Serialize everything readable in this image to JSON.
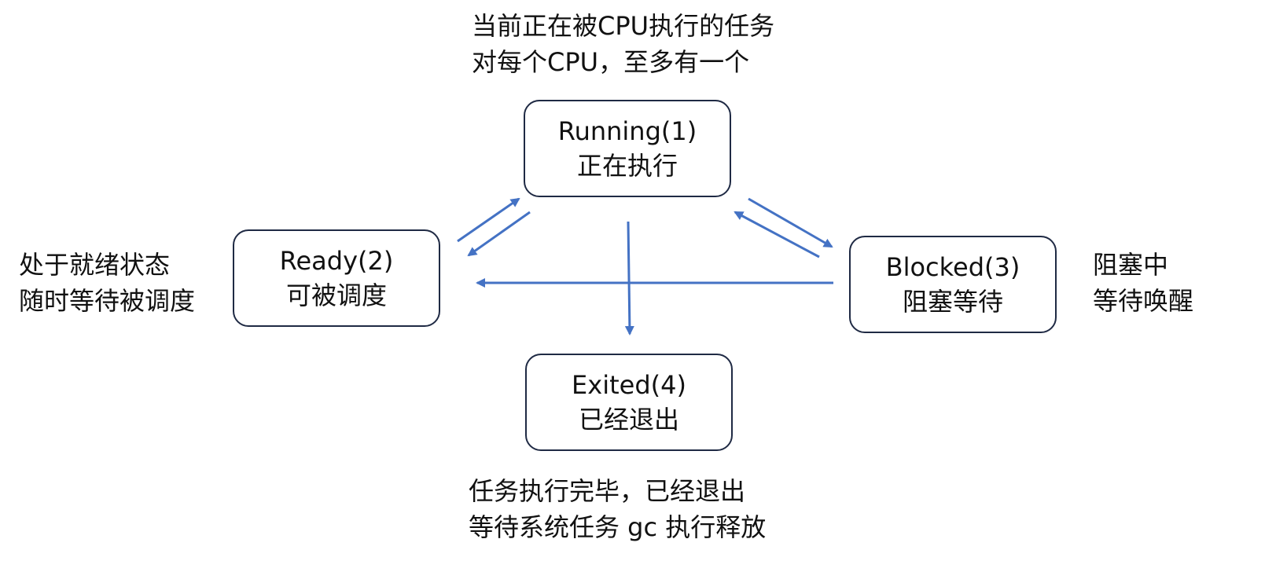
{
  "states": {
    "running": {
      "name": "Running(1)",
      "desc": "正在执行"
    },
    "ready": {
      "name": "Ready(2)",
      "desc": "可被调度"
    },
    "blocked": {
      "name": "Blocked(3)",
      "desc": "阻塞等待"
    },
    "exited": {
      "name": "Exited(4)",
      "desc": "已经退出"
    }
  },
  "notes": {
    "running": [
      "当前正在被CPU执行的任务",
      "对每个CPU，至多有一个"
    ],
    "ready": [
      "处于就绪状态",
      "随时等待被调度"
    ],
    "blocked": [
      "阻塞中",
      "等待唤醒"
    ],
    "exited": [
      "任务执行完毕，已经退出",
      "等待系统任务 gc 执行释放"
    ]
  },
  "colors": {
    "arrow": "#4472c4",
    "box_border": "#1f2a44"
  }
}
